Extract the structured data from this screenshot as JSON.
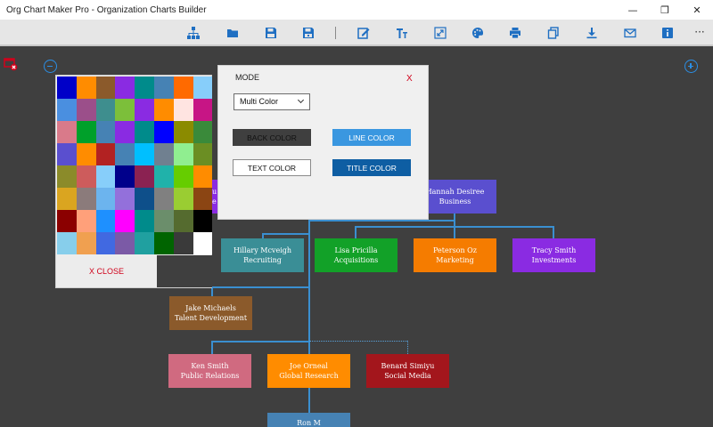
{
  "window": {
    "title": "Org Chart Maker Pro - Organization Charts Builder",
    "controls": {
      "minimize": "—",
      "restore": "❐",
      "close": "✕"
    }
  },
  "toolbar": {
    "icons": [
      "org-chart-icon",
      "open-folder-icon",
      "save-icon",
      "save-as-icon",
      "edit-icon",
      "text-format-icon",
      "resize-icon",
      "palette-icon",
      "print-icon",
      "copy-icon",
      "download-icon",
      "mail-icon",
      "info-icon"
    ],
    "more": "···",
    "icon_color": "#1f6fc2"
  },
  "picker": {
    "colors": [
      "#0000c8",
      "#ff8c00",
      "#8b5a2b",
      "#8a2be2",
      "#008b8b",
      "#4682b4",
      "#ff6a00",
      "#87cefa",
      "#4a8fe0",
      "#9b4f8a",
      "#3e8e8e",
      "#7cbf3a",
      "#8a2be2",
      "#ff8c00",
      "#ffe4e1",
      "#c71585",
      "#d97a8a",
      "#00a02a",
      "#4682b4",
      "#8a2be2",
      "#008b8b",
      "#0000ff",
      "#8b8b00",
      "#3a8a3a",
      "#5a4fcf",
      "#ff8c00",
      "#b22222",
      "#4682b4",
      "#00bfff",
      "#708090",
      "#90ee90",
      "#6b8e23",
      "#8b8b2a",
      "#cd5c5c",
      "#87cefa",
      "#00008b",
      "#8b2252",
      "#20b2aa",
      "#66cd00",
      "#ff8c00",
      "#daa520",
      "#8b7b7b",
      "#6cb4ee",
      "#9370db",
      "#0e4f8a",
      "#808080",
      "#9acd32",
      "#8b4513",
      "#8b0000",
      "#ffa07a",
      "#1e90ff",
      "#ff00ff",
      "#008b8b",
      "#6b8e6b",
      "#556b2f",
      "#000000",
      "#87ceeb",
      "#f0a050",
      "#4169e1",
      "#7b5aa6",
      "#20a0a0",
      "#006400",
      "#3a3a3a",
      "#ffffff"
    ],
    "close_label": "X CLOSE"
  },
  "dialog": {
    "title": "MODE",
    "close": "X",
    "mode_select": "Multi Color",
    "back_color_label": "BACK COLOR",
    "line_color_label": "LINE COLOR",
    "text_color_label": "TEXT COLOR",
    "title_color_label": "TITLE COLOR",
    "back_color": "#3f3f3f",
    "line_color": "#3a97e0",
    "text_color": "#ffffff",
    "title_color": "#0e5ea3"
  },
  "nodes": {
    "hannah": {
      "name": "Hannah Desiree",
      "dept": "Business",
      "color": "#5a4fcf"
    },
    "hillary": {
      "name": "Hillary Mcveigh",
      "dept": "Recruiting",
      "color": "#3a8e96"
    },
    "lisa": {
      "name": "Lisa Pricilla",
      "dept": "Acquisitions",
      "color": "#12a128"
    },
    "peterson": {
      "name": "Peterson Oz",
      "dept": "Marketing",
      "color": "#f57c00"
    },
    "tracy": {
      "name": "Tracy Smith",
      "dept": "Investments",
      "color": "#8a2be2"
    },
    "jake": {
      "name": "Jake Michaels",
      "dept": "Talent Development",
      "color": "#8b5a2b"
    },
    "ken": {
      "name": "Ken Smith",
      "dept": "Public Relations",
      "color": "#d06a80"
    },
    "joe": {
      "name": "Joe Orneal",
      "dept": "Global Research",
      "color": "#ff8c00"
    },
    "benard": {
      "name": "Benard Simiyu",
      "dept": "Social Media",
      "color": "#a3161c"
    },
    "partial_left_1": "Ru",
    "partial_left_2": "Re",
    "partial_bottom": "Ron M"
  }
}
